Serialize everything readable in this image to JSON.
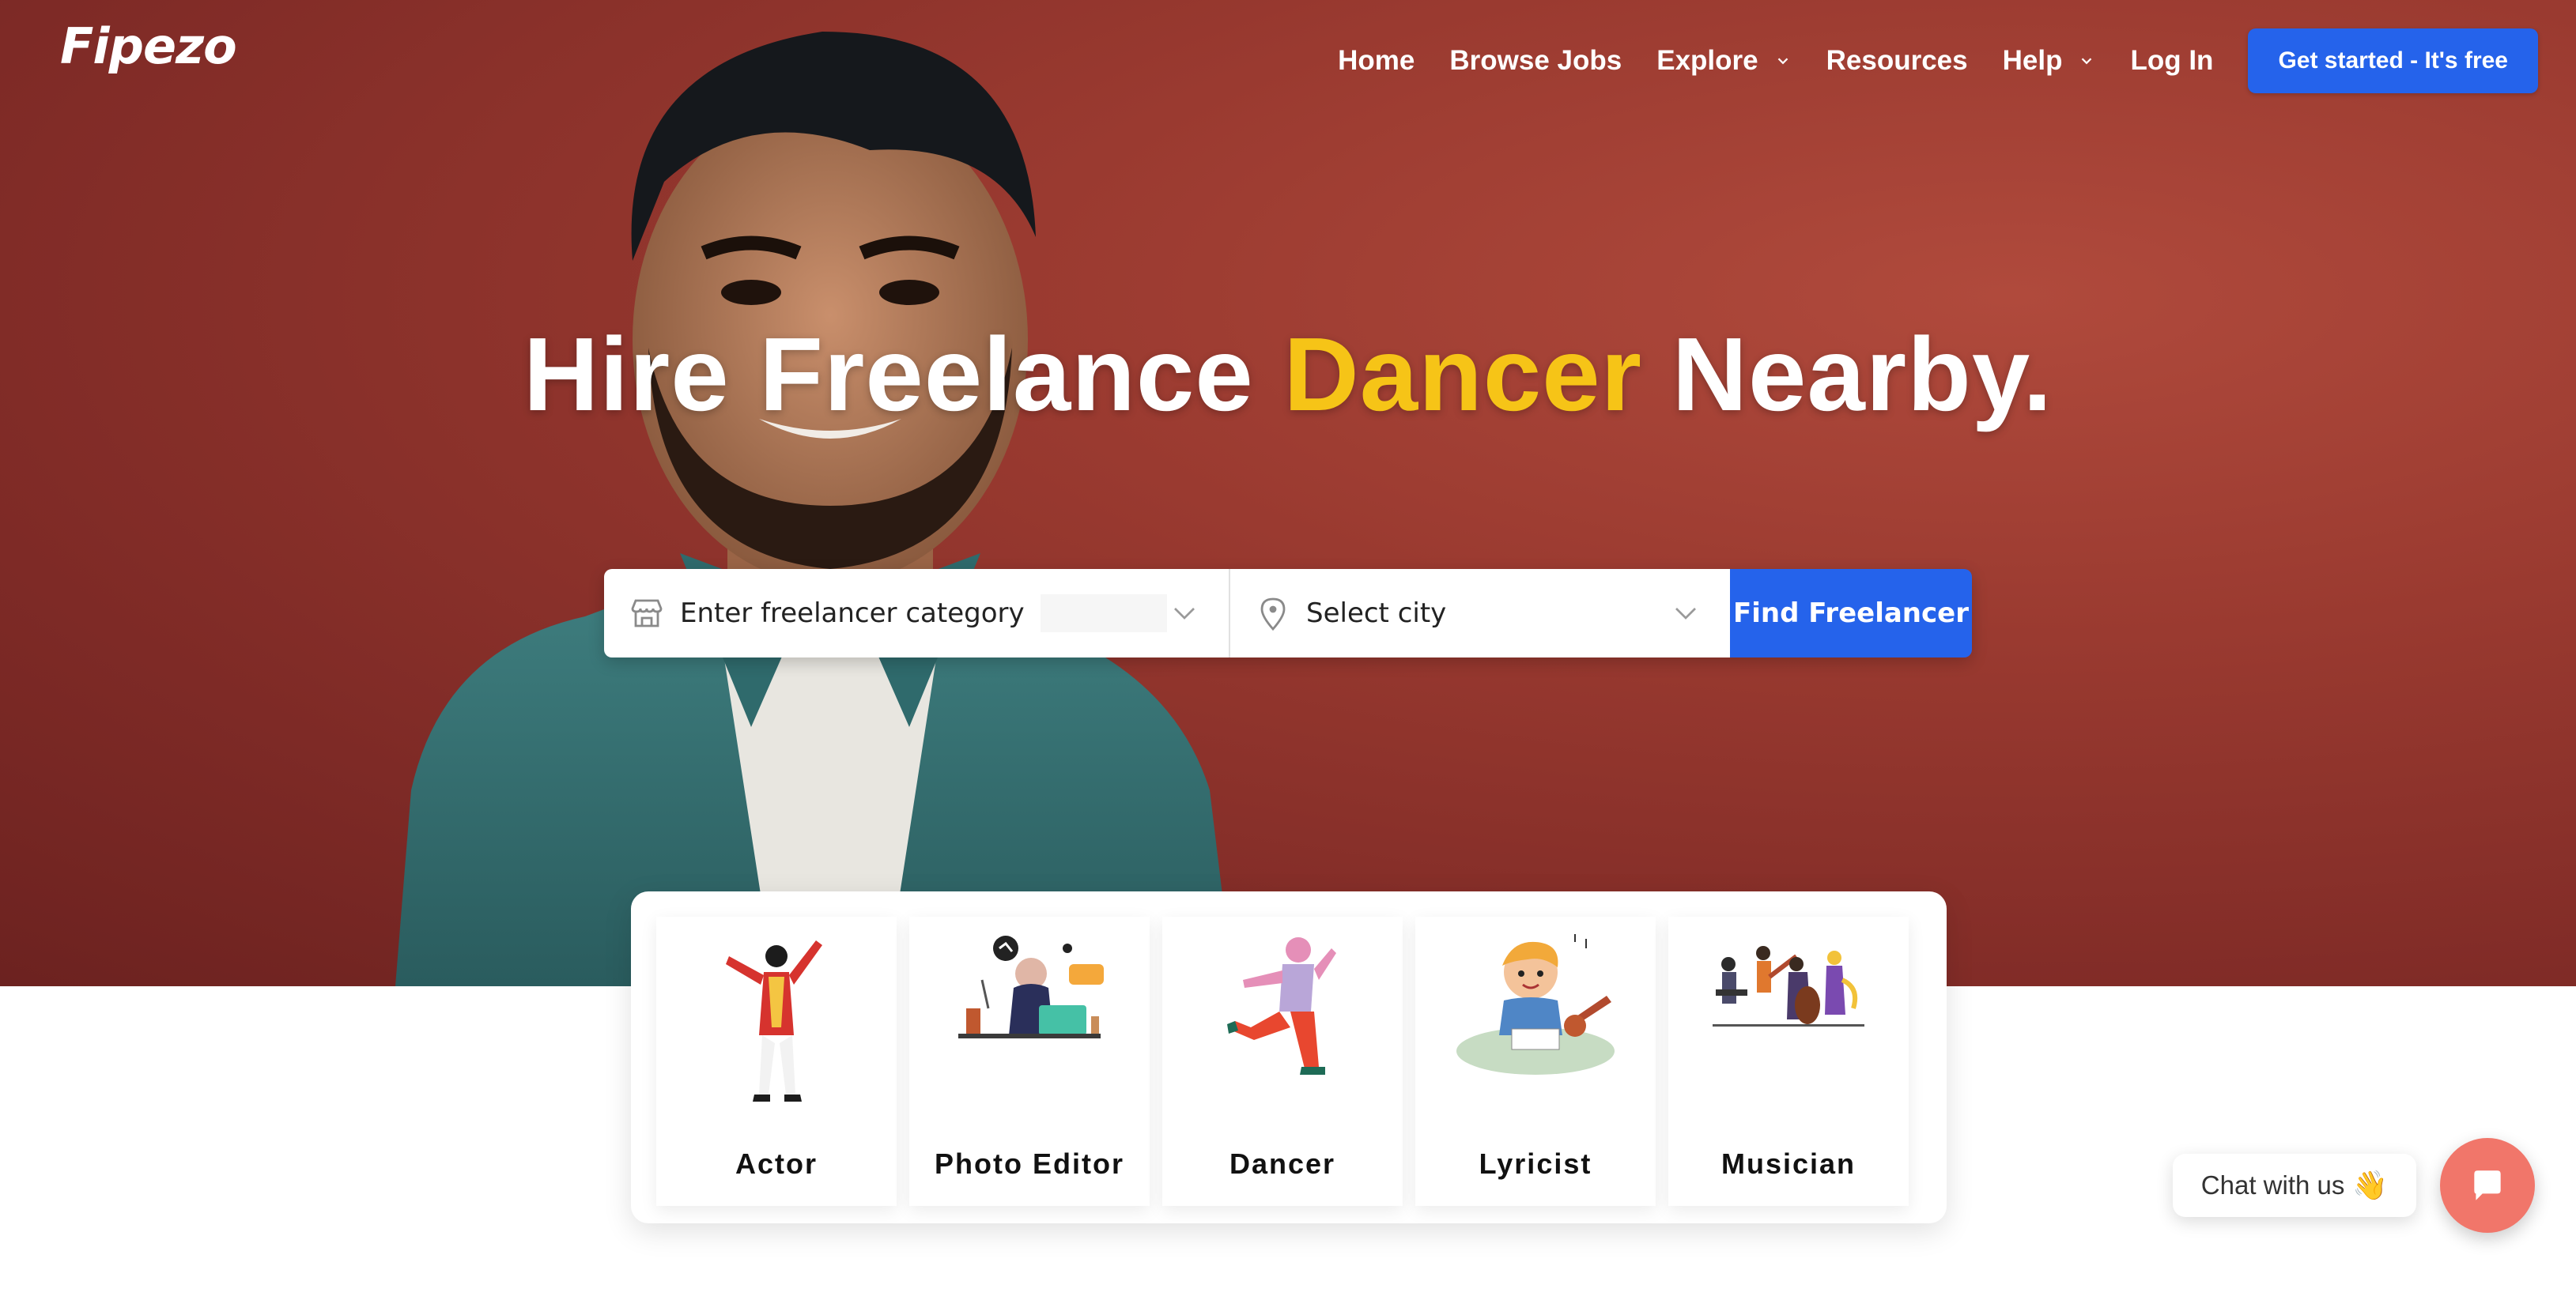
{
  "header": {
    "logo": "Fipezo",
    "nav": [
      {
        "label": "Home",
        "has_dropdown": false
      },
      {
        "label": "Browse Jobs",
        "has_dropdown": false
      },
      {
        "label": "Explore",
        "has_dropdown": true
      },
      {
        "label": "Resources",
        "has_dropdown": false
      },
      {
        "label": "Help",
        "has_dropdown": true
      },
      {
        "label": "Log In",
        "has_dropdown": false
      }
    ],
    "cta_label": "Get started - It's free"
  },
  "hero": {
    "headline_before": "Hire Freelance",
    "headline_accent": "Dancer",
    "headline_after": "Nearby.",
    "accent_color": "#f6c417",
    "background_color": "#9a3a30"
  },
  "search": {
    "category_placeholder": "Enter freelancer category",
    "city_placeholder": "Select city",
    "button_label": "Find Freelancer",
    "button_color": "#2563eb"
  },
  "categories": [
    {
      "label": "Actor",
      "icon": "actor-illustration"
    },
    {
      "label": "Photo Editor",
      "icon": "photo-editor-illustration"
    },
    {
      "label": "Dancer",
      "icon": "dancer-illustration"
    },
    {
      "label": "Lyricist",
      "icon": "lyricist-illustration"
    },
    {
      "label": "Musician",
      "icon": "musician-illustration"
    }
  ],
  "chat": {
    "label": "Chat with us",
    "emoji": "👋",
    "fab_color": "#f1766a"
  }
}
